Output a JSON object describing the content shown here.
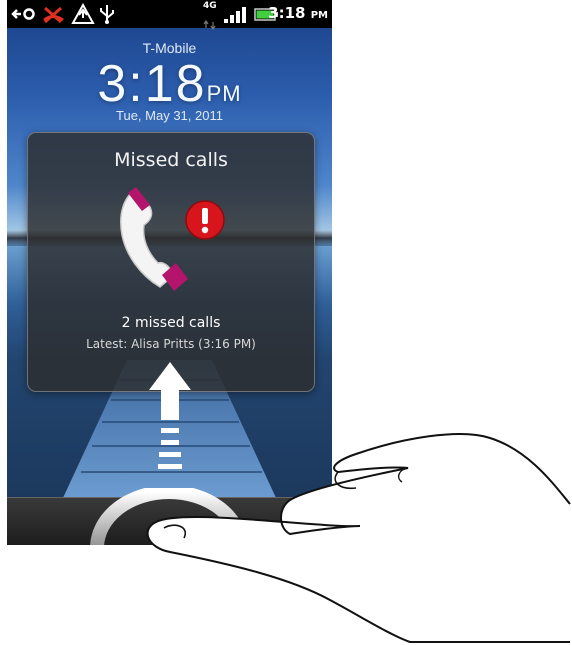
{
  "status_bar": {
    "network_type": "4G",
    "time": "3:18",
    "time_suffix": "PM"
  },
  "lockscreen": {
    "carrier": "T-Mobile",
    "clock_time": "3:18",
    "clock_suffix": "PM",
    "date": "Tue, May 31, 2011"
  },
  "notification": {
    "title": "Missed calls",
    "count_text": "2 missed calls",
    "latest_text": "Latest: Alisa Pritts (3:16 PM)",
    "icons": [
      "phone-handset-icon",
      "alert-icon"
    ]
  },
  "unlock": {
    "icons": [
      "swipe-up-arrow-icon",
      "unlock-ring-icon"
    ]
  },
  "colors": {
    "alert_red": "#d8141c",
    "handset_magenta": "#b5146c",
    "battery_green": "#3fcf3f",
    "missed_call_red": "#e0301e"
  }
}
